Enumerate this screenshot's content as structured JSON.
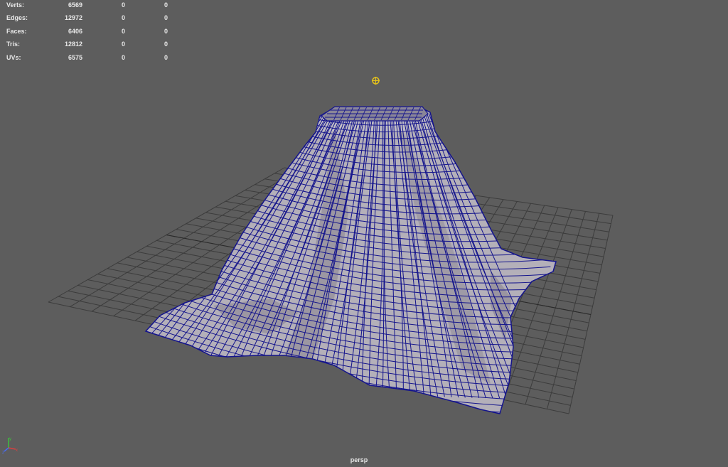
{
  "stats": [
    {
      "label": "Verts:",
      "values": [
        "6569",
        "0",
        "0"
      ]
    },
    {
      "label": "Edges:",
      "values": [
        "12972",
        "0",
        "0"
      ]
    },
    {
      "label": "Faces:",
      "values": [
        "6406",
        "0",
        "0"
      ]
    },
    {
      "label": "Tris:",
      "values": [
        "12812",
        "0",
        "0"
      ]
    },
    {
      "label": "UVs:",
      "values": [
        "6575",
        "0",
        "0"
      ]
    }
  ],
  "camera": "persp",
  "axis": {
    "y_label": "y",
    "x_label": "x",
    "z_label": "z"
  },
  "colors": {
    "background": "#5d5d5d",
    "grid": "#3c3c3c",
    "cloth_fill": "#b4b0b9",
    "wire": "#14148c",
    "pivot": "#e6c21a",
    "hud_text": "#e8e8e8"
  }
}
